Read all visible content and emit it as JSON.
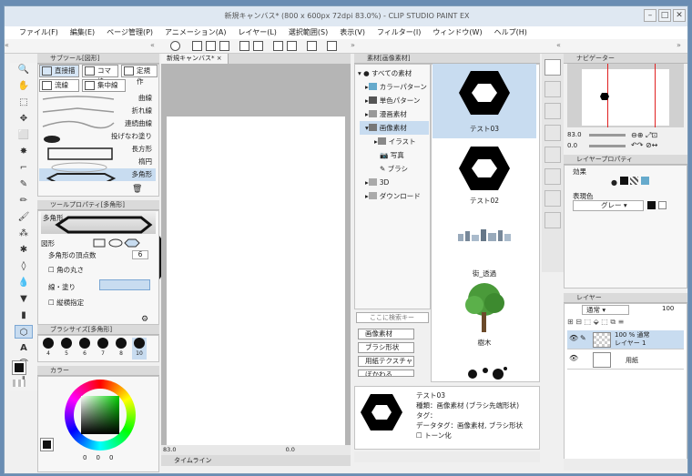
{
  "window": {
    "title": "新規キャンバス* (800 x 600px 72dpi 83.0%) - CLIP STUDIO PAINT EX",
    "buttons": [
      "–",
      "□",
      "✕"
    ]
  },
  "menu": [
    "ファイル(F)",
    "編集(E)",
    "ページ管理(P)",
    "アニメーション(A)",
    "レイヤー(L)",
    "選択範囲(S)",
    "表示(V)",
    "フィルター(I)",
    "ウィンドウ(W)",
    "ヘルプ(H)"
  ],
  "tool_panel": {
    "header": "サブツール[図形]",
    "tabs": [
      "直接描",
      "コマ枠",
      "定規作",
      "流線",
      "集中線"
    ],
    "subtools": [
      "曲線",
      "折れ線",
      "連続曲線",
      "投げなわ塗り",
      "長方形",
      "楕円",
      "多角形"
    ],
    "selected": "多角形"
  },
  "tool_property": {
    "header": "ツールプロパティ[多角形]",
    "preview_label": "多角形",
    "sections": {
      "shape": "図形",
      "vertices_label": "多角形の頂点数",
      "vertices_value": "6",
      "rounded": "角の丸さ",
      "line_fill": "線・塗り",
      "aspect": "縦横指定"
    }
  },
  "brush_size": {
    "header": "ブラシサイズ[多角形]",
    "sizes": [
      "4",
      "5",
      "6",
      "7",
      "8",
      "10"
    ]
  },
  "color": {
    "header": "カラー",
    "values": [
      "0",
      "0",
      "0"
    ]
  },
  "canvas": {
    "tab": "新規キャンバス*",
    "zoom": "83.0",
    "footer_value": "0.0",
    "timeline": "タイムライン"
  },
  "material": {
    "header": "素材[画像素材]",
    "tree": [
      "すべての素材",
      "カラーパターン",
      "単色パターン",
      "漫画素材",
      "画像素材",
      "イラスト",
      "写真",
      "ブラシ",
      "3D",
      "ダウンロード"
    ],
    "search_placeholder": "ここに検索キー",
    "tags": [
      "画像素材",
      "ブラシ形状",
      "用紙テクスチャ",
      "ぼかわる"
    ],
    "items": [
      "テスト03",
      "テスト02",
      "街_透過",
      "樹木"
    ],
    "detail": {
      "name": "テスト03",
      "kind": "種類：画像素材 (ブラシ先端形状)",
      "tag": "タグ：",
      "datatag": "データタグ：画像素材, ブラシ形状",
      "tone": "トーン化"
    }
  },
  "navigator": {
    "header": "ナビゲーター",
    "zoom": "83.0",
    "angle": "0.0"
  },
  "layer_property": {
    "header": "レイヤープロパティ",
    "effect": "効果",
    "color_label": "表現色",
    "color_value": "グレー"
  },
  "layers": {
    "header": "レイヤー",
    "blend": "通常",
    "opacity": "100",
    "rows": [
      {
        "top": "100 % 通常",
        "name": "レイヤー 1"
      },
      {
        "top": "",
        "name": "用紙"
      }
    ]
  }
}
